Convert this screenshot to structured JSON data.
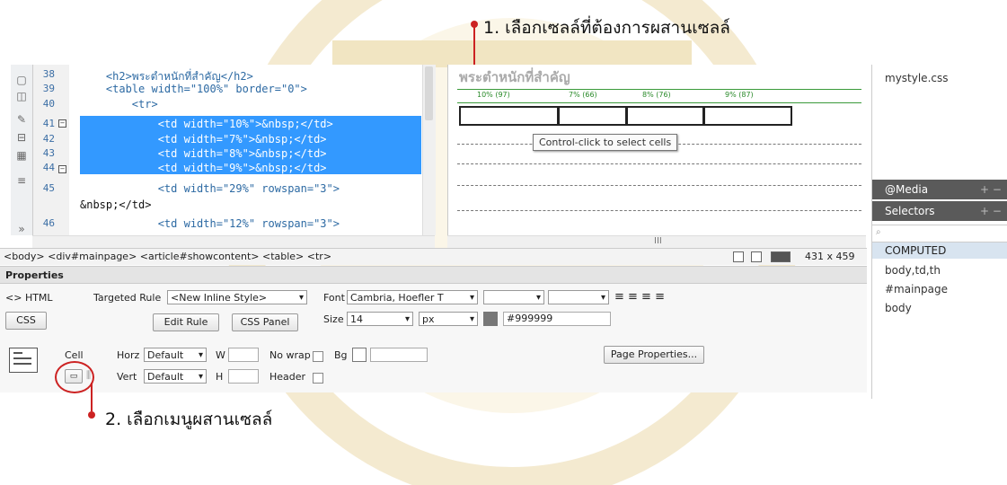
{
  "annotations": {
    "top": "1. เลือกเซลล์ที่ต้องการผสานเซลล์",
    "bottom": "2. เลือกเมนูผสานเซลล์"
  },
  "code_view": {
    "lines": [
      {
        "n": "38",
        "text": "    <h2>พระตำหนักที่สำคัญ</h2>"
      },
      {
        "n": "39",
        "text": "    <table width=\"100%\" border=\"0\">"
      },
      {
        "n": "40",
        "text": "        <tr>"
      },
      {
        "n": "41",
        "text": "            <td width=\"10%\">&nbsp;</td>"
      },
      {
        "n": "42",
        "text": "            <td width=\"7%\">&nbsp;</td>"
      },
      {
        "n": "43",
        "text": "            <td width=\"8%\">&nbsp;</td>"
      },
      {
        "n": "44",
        "text": "            <td width=\"9%\">&nbsp;</td>"
      },
      {
        "n": "45",
        "text": "            <td width=\"29%\" rowspan=\"3\">"
      },
      {
        "n": "",
        "text": "&nbsp;</td>"
      },
      {
        "n": "46",
        "text": "            <td width=\"12%\" rowspan=\"3\">"
      }
    ]
  },
  "design_view": {
    "title": "พระตำหนักที่สำคัญ",
    "ruler": [
      "10% (97)",
      "7% (66)",
      "8% (76)",
      "9% (87)"
    ],
    "tooltip": "Control-click to select cells",
    "scroll_label": "III"
  },
  "status_bar": {
    "tag_selector": "<body> <div#mainpage> <article#showcontent> <table> <tr>",
    "size": "431 x 459"
  },
  "properties": {
    "title": "Properties",
    "html_label": "HTML",
    "css_label": "CSS",
    "targeted_rule_label": "Targeted Rule",
    "targeted_rule_value": "<New Inline Style>",
    "edit_rule": "Edit Rule",
    "css_panel": "CSS Panel",
    "font_label": "Font",
    "font_value": "Cambria, Hoefler T",
    "size_label": "Size",
    "size_value": "14",
    "size_unit": "px",
    "color_value": "#999999",
    "cell_label": "Cell",
    "horz_label": "Horz",
    "horz_value": "Default",
    "vert_label": "Vert",
    "vert_value": "Default",
    "w_label": "W",
    "h_label": "H",
    "nowrap_label": "No wrap",
    "bg_label": "Bg",
    "header_label": "Header",
    "page_properties": "Page Properties...",
    "merge_icon": "merge-cells-icon",
    "split_icon": "split-cells-icon"
  },
  "right_panel": {
    "file": "mystyle.css",
    "media": "@Media",
    "selectors": "Selectors",
    "computed": "COMPUTED",
    "items": [
      "body,td,th",
      "#mainpage",
      "body"
    ]
  }
}
